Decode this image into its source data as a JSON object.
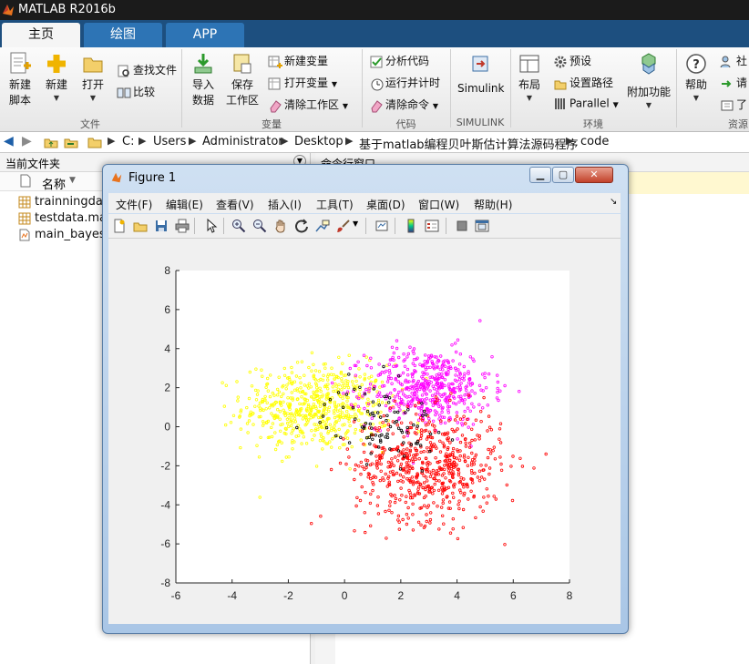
{
  "app": {
    "title": "MATLAB R2016b"
  },
  "tabs": [
    {
      "label": "主页"
    },
    {
      "label": "绘图"
    },
    {
      "label": "APP"
    }
  ],
  "ribbon": {
    "file_group": {
      "label": "文件",
      "new_script": [
        "新建",
        "脚本"
      ],
      "new": "新建",
      "open": "打开",
      "find_files": "查找文件",
      "compare": "比较"
    },
    "variable_group": {
      "label": "变量",
      "import": [
        "导入",
        "数据"
      ],
      "save": [
        "保存",
        "工作区"
      ],
      "new_var": "新建变量",
      "open_var": "打开变量",
      "clear_ws": "清除工作区"
    },
    "code_group": {
      "label": "代码",
      "analyze": "分析代码",
      "run_time": "运行并计时",
      "clear_cmd": "清除命令"
    },
    "simulink_group": {
      "label": "SIMULINK",
      "simulink": "Simulink"
    },
    "env_group": {
      "label": "环境",
      "layout": "布局",
      "prefs": "预设",
      "set_path": "设置路径",
      "parallel": "Parallel",
      "addons": "附加功能"
    },
    "resources_group": {
      "label": "资源",
      "help": "帮助",
      "community": "社",
      "request": "请",
      "learn": "了"
    }
  },
  "address": {
    "path": [
      "C:",
      "Users",
      "Administrator",
      "Desktop",
      "基于matlab编程贝叶斯估计算法源码程序",
      "code"
    ]
  },
  "current_folder": {
    "title": "当前文件夹",
    "column_name": "名称",
    "files": [
      {
        "name": "trainningdat",
        "type": "mat"
      },
      {
        "name": "testdata.mat",
        "type": "mat"
      },
      {
        "name": "main_bayes.",
        "type": "m"
      }
    ]
  },
  "command_window": {
    "title": "命令行窗口"
  },
  "figure": {
    "title": "Figure 1",
    "menus": [
      "文件(F)",
      "编辑(E)",
      "查看(V)",
      "插入(I)",
      "工具(T)",
      "桌面(D)",
      "窗口(W)",
      "帮助(H)"
    ],
    "toolbar_icons": [
      "new-figure-icon",
      "open-icon",
      "save-icon",
      "print-icon",
      "pointer-icon",
      "zoom-in-icon",
      "zoom-out-icon",
      "pan-icon",
      "rotate-icon",
      "datacursor-icon",
      "brush-icon",
      "link-icon",
      "colorbar-icon",
      "legend-icon",
      "hide-plot-tools-icon",
      "show-plot-tools-icon"
    ]
  },
  "chart_data": {
    "type": "scatter",
    "xlim": [
      -6,
      8
    ],
    "ylim": [
      -8,
      8
    ],
    "xticks": [
      -6,
      -4,
      -2,
      0,
      2,
      4,
      6,
      8
    ],
    "yticks": [
      -8,
      -6,
      -4,
      -2,
      0,
      2,
      4,
      6,
      8
    ],
    "grid": false,
    "series": [
      {
        "color": "#ffff00",
        "marker": "o",
        "count": 600,
        "center": [
          -1,
          1
        ],
        "std": [
          1.3,
          1.1
        ]
      },
      {
        "color": "#ff00ff",
        "marker": "o",
        "count": 500,
        "center": [
          3,
          2
        ],
        "std": [
          1.1,
          1.0
        ]
      },
      {
        "color": "#ff0000",
        "marker": "o",
        "count": 600,
        "center": [
          3,
          -2
        ],
        "std": [
          1.3,
          1.4
        ]
      },
      {
        "color": "#000000",
        "marker": "o",
        "count": 90,
        "center": [
          1.3,
          0.2
        ],
        "std": [
          1.0,
          1.0
        ]
      }
    ]
  }
}
